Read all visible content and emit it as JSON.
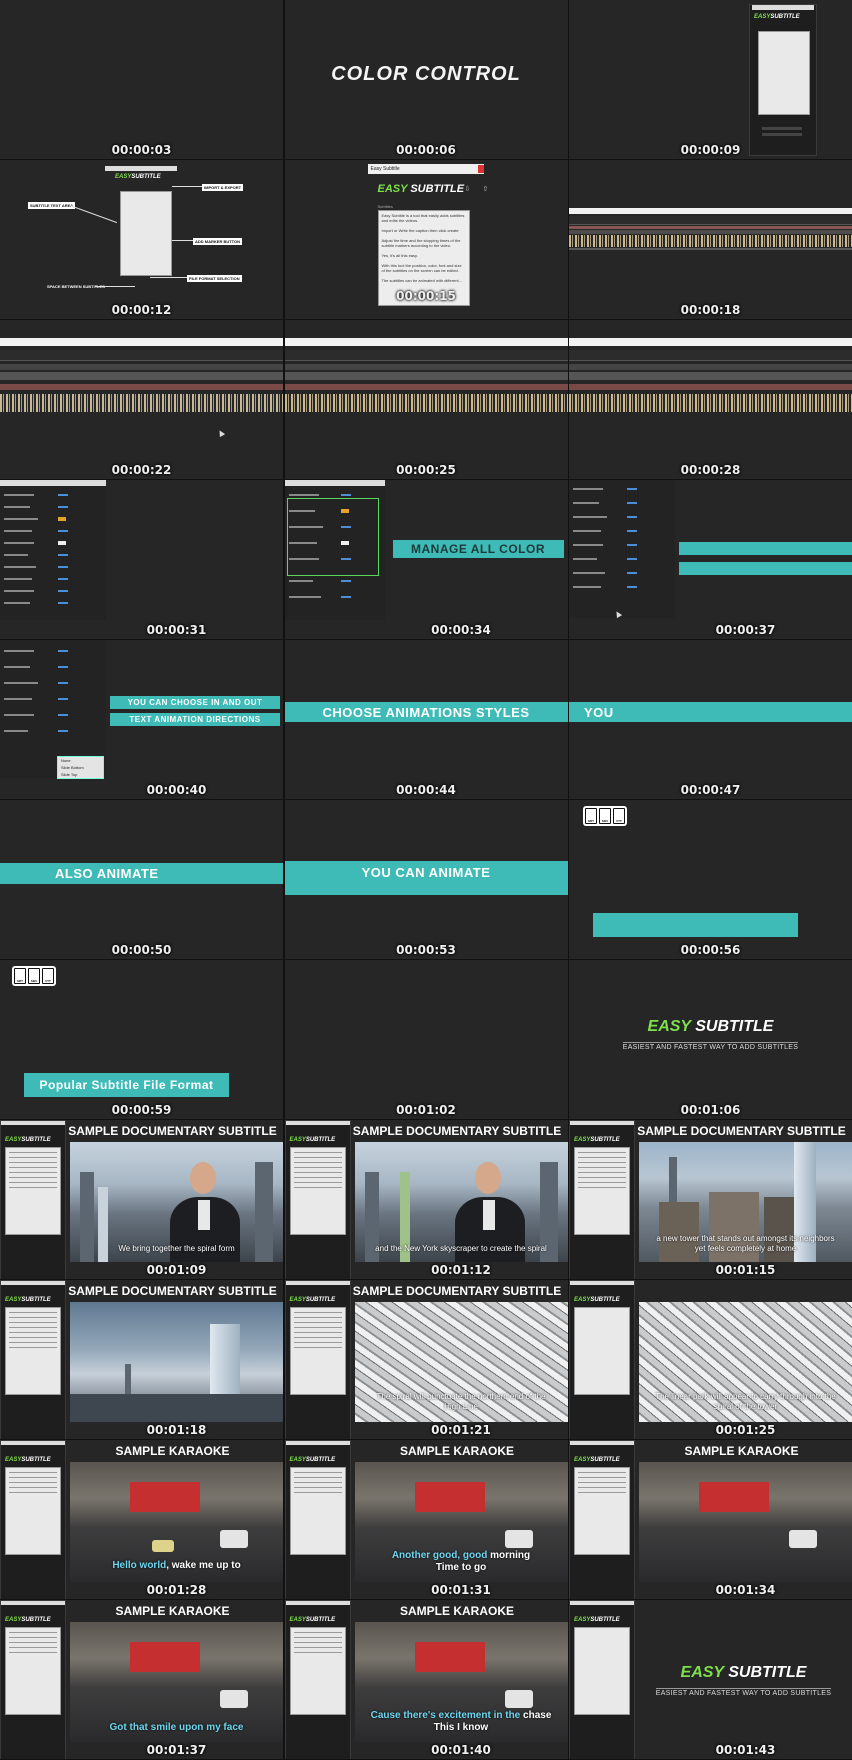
{
  "timestamps": [
    "00:00:03",
    "00:00:06",
    "00:00:09",
    "00:00:12",
    "00:00:15",
    "00:00:18",
    "00:00:22",
    "00:00:25",
    "00:00:28",
    "00:00:31",
    "00:00:34",
    "00:00:37",
    "00:00:40",
    "00:00:44",
    "00:00:47",
    "00:00:50",
    "00:00:53",
    "00:00:56",
    "00:00:59",
    "00:01:02",
    "00:01:06",
    "00:01:09",
    "00:01:12",
    "00:01:15",
    "00:01:18",
    "00:01:21",
    "00:01:25",
    "00:01:28",
    "00:01:31",
    "00:01:34",
    "00:01:37",
    "00:01:40",
    "00:01:43"
  ],
  "logo": {
    "easy": "EASY",
    "subtitle": "SUBTITLE",
    "tagline": "EASIEST AND FASTEST WAY TO ADD SUBTITLES"
  },
  "titles": {
    "color_control": "COLOR CONTROL",
    "manage_all_color": "MANAGE ALL COLOR",
    "in_and_out": "YOU CAN CHOOSE IN AND OUT",
    "text_animation": "TEXT ANIMATION DIRECTIONS",
    "choose_animations": "CHOOSE ANIMATIONS STYLES",
    "you": "YOU",
    "also_animate": "ALSO ANIMATE",
    "you_can_animate": "YOU CAN ANIMATE",
    "popular_format": "Popular Subtitle File Format",
    "sample_doc": "SAMPLE DOCUMENTARY SUBTITLE",
    "sample_karaoke": "SAMPLE KARAOKE"
  },
  "callouts": {
    "import_export": "IMPORT & EXPORT",
    "subtitle_text_area": "SUBTITLE TEXT AREA",
    "add_marker": "ADD MARKER BUTTON",
    "file_format": "FILE FORMAT SELECTION",
    "space_between": "SPACE BETWEEN SUBTITLES"
  },
  "panel_window": {
    "title": "Easy Subtitle",
    "subtitles_label": "Subtitles",
    "paragraphs": [
      "Easy Subtitle is a tool that easily adds subtitles and edits the videos.",
      "Import or Write the caption then click create",
      "Adjust the time and the stopping times of the subtitle markers according to the video.",
      "Yes, it's all this easy.",
      "With this tool the position, color, font and size of the subtitles on the screen can be edited.",
      "The subtitles can be animated with different..."
    ]
  },
  "dropdown_options": [
    "None",
    "Slide Bottom",
    "Slide Top"
  ],
  "file_icons": [
    "SRT",
    "SBV",
    "VTT"
  ],
  "captions": {
    "c1": "We bring together the spiral form",
    "c2": "and the New York skyscraper to create the spiral",
    "c3a": "a new tower that stands out amongst its neighbors",
    "c3b": "yet feels completely at home",
    "c5": "The spiral will punctuate the northern end of the",
    "c5b": "High Line",
    "c6": "The linear park will appear to carry through into the",
    "c6b": "spiral of the tower"
  },
  "karaoke": {
    "k1_hl": "Hello world",
    "k1_rest": ", wake me up to",
    "k2_hl": "Another good, good",
    "k2_rest": " morning",
    "k2_line2": "Time to go",
    "k4": "Got that smile upon my face",
    "k5_hl": "Cause there's excitement in the",
    "k5_rest": " chase",
    "k5_line2": "This I know"
  },
  "colors": {
    "accent_teal": "#3ebbb7",
    "logo_green": "#7ee04a",
    "background": "#262626"
  }
}
